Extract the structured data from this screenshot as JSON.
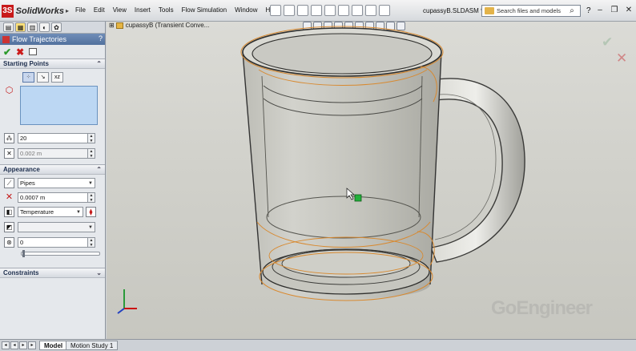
{
  "app": {
    "name": "SolidWorks",
    "document_title": "cupassyB.SLDASM *",
    "menus": [
      "File",
      "Edit",
      "View",
      "Insert",
      "Tools",
      "Flow Simulation",
      "Window",
      "Help"
    ]
  },
  "search": {
    "placeholder": "Search files and models"
  },
  "property_manager": {
    "title": "Flow Trajectories",
    "sections": {
      "starting_points": {
        "label": "Starting Points",
        "number_of_points": "20",
        "offset": "0.002 m"
      },
      "appearance": {
        "label": "Appearance",
        "draw_as": "Pipes",
        "width": "0.0007 m",
        "color_by": "Temperature",
        "color_value": "",
        "max_length": "0"
      },
      "constraints": {
        "label": "Constraints"
      }
    }
  },
  "viewport": {
    "tree_node": "cupassyB (Transient Conve...",
    "watermark": "GoEngineer"
  },
  "bottom_tabs": [
    {
      "label": "Model",
      "active": true
    },
    {
      "label": "Motion Study 1",
      "active": false
    }
  ],
  "colors": {
    "accent": "#52719e",
    "selection_box": "#bcd7f3",
    "outline_orange": "#d8892f",
    "marker_green": "#22b03a"
  }
}
